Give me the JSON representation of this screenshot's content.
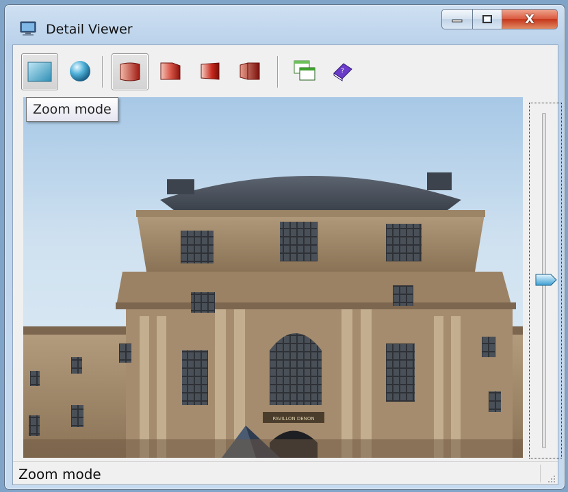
{
  "window": {
    "title": "Detail Viewer",
    "app_icon": "monitor-icon",
    "controls": [
      "minimize-icon",
      "maximize-icon",
      "close-icon"
    ],
    "close_label": "X"
  },
  "toolbar": {
    "buttons": [
      {
        "name": "zoom-mode",
        "icon": "zoom-mode-icon",
        "checked": true
      },
      {
        "name": "sphere-mode",
        "icon": "sphere-icon",
        "checked": false
      },
      {
        "name": "effect-1",
        "icon": "page-red-1-icon",
        "checked": true
      },
      {
        "name": "effect-2",
        "icon": "page-red-2-icon",
        "checked": false
      },
      {
        "name": "effect-3",
        "icon": "page-red-3-icon",
        "checked": false
      },
      {
        "name": "effect-4",
        "icon": "page-red-4-icon",
        "checked": false
      },
      {
        "name": "new-window",
        "icon": "windows-icon",
        "checked": false
      },
      {
        "name": "help",
        "icon": "help-book-icon",
        "checked": false
      }
    ]
  },
  "tooltip": {
    "text": "Zoom mode"
  },
  "image": {
    "subject": "Louvre Pavillon facade",
    "sign_text": "PAVILLON DENON"
  },
  "zoom_slider": {
    "value_fraction": 0.5
  },
  "status": {
    "text": "Zoom mode"
  },
  "colors": {
    "accent": "#3b7fc4",
    "sky": "#c7dcef",
    "stone": "#a2896a",
    "close_red": "#c4361b"
  }
}
